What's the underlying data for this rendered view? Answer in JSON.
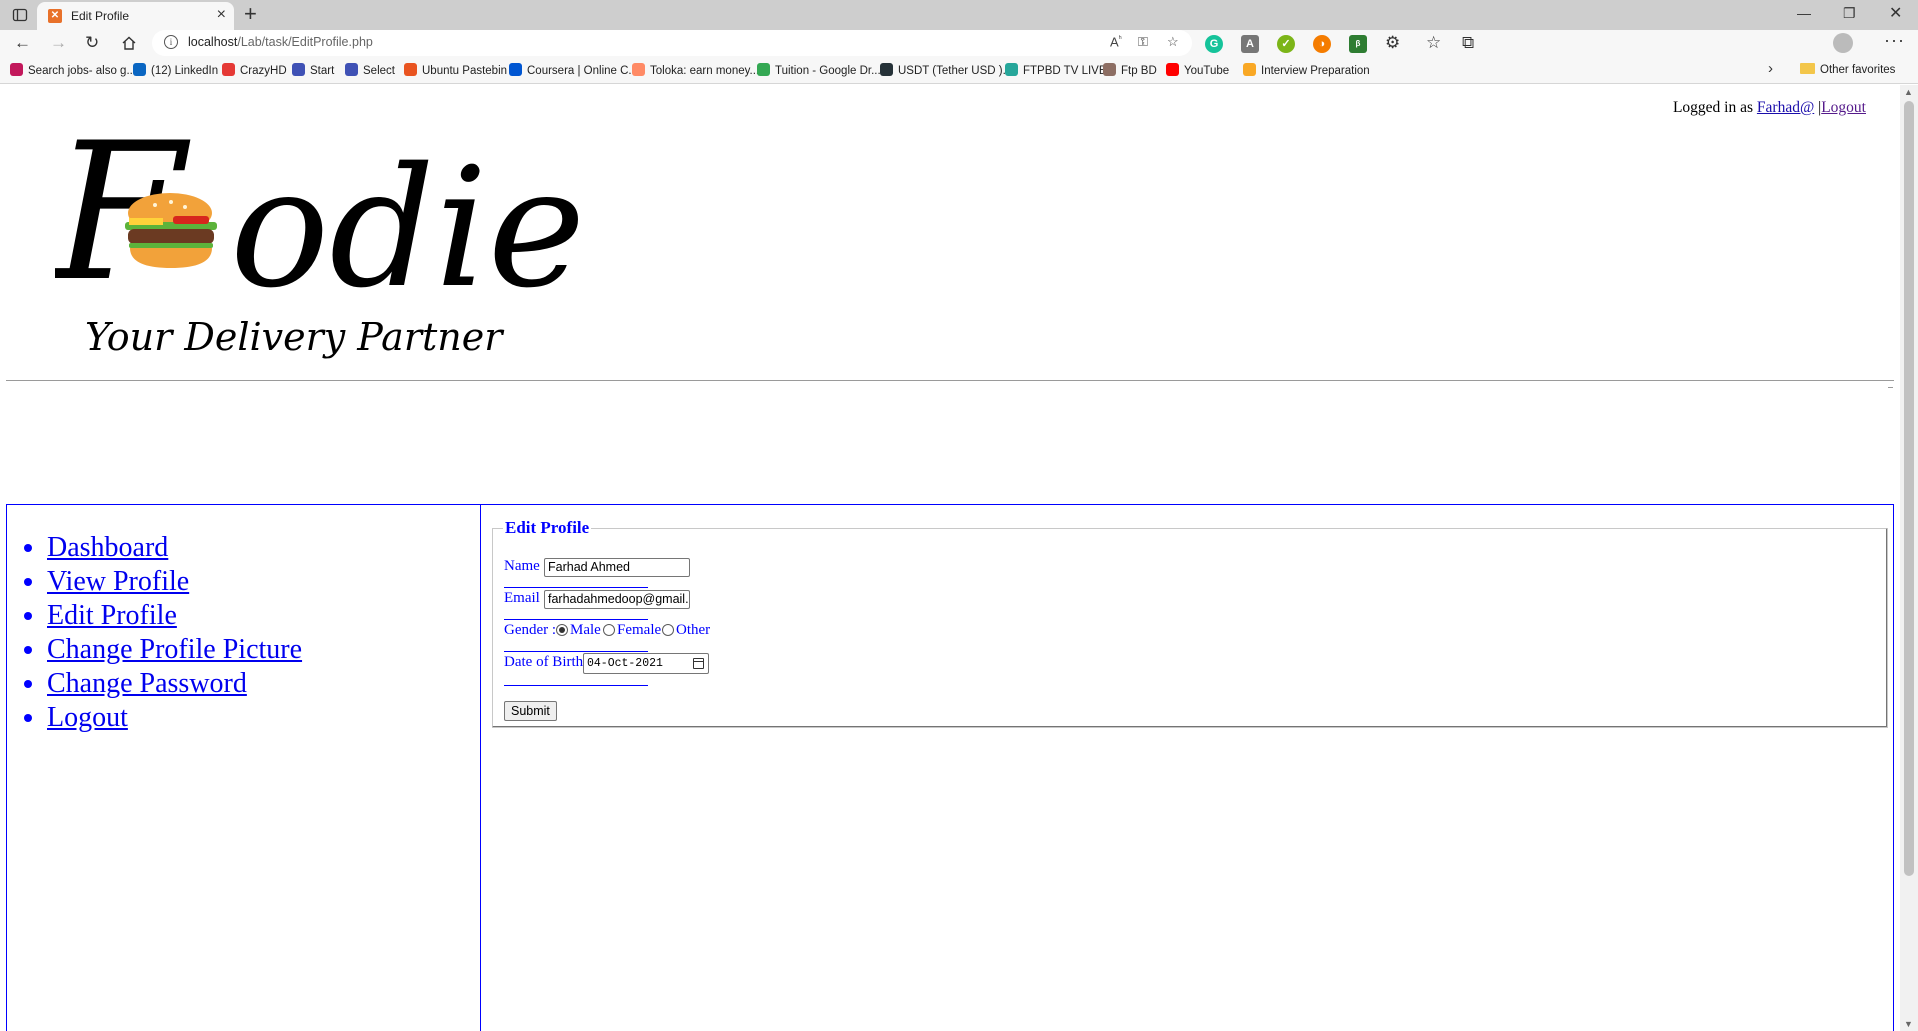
{
  "browser": {
    "tab_title": "Edit Profile",
    "url_host": "localhost",
    "url_path": "/Lab/task/EditProfile.php",
    "bookmarks": [
      {
        "label": "Search jobs- also g...",
        "color": "#c2185b"
      },
      {
        "label": "(12) LinkedIn",
        "color": "#0a66c2"
      },
      {
        "label": "CrazyHD",
        "color": "#e53935"
      },
      {
        "label": "Start",
        "color": "#3f51b5"
      },
      {
        "label": "Select",
        "color": "#3f51b5"
      },
      {
        "label": "Ubuntu Pastebin",
        "color": "#e95420"
      },
      {
        "label": "Coursera | Online C...",
        "color": "#0056d2"
      },
      {
        "label": "Toloka: earn money...",
        "color": "#ff8a65"
      },
      {
        "label": "Tuition - Google Dr...",
        "color": "#34a853"
      },
      {
        "label": "USDT (Tether USD )...",
        "color": "#263238"
      },
      {
        "label": "FTPBD TV LIVE!",
        "color": "#26a69a"
      },
      {
        "label": "Ftp BD",
        "color": "#8d6e63"
      },
      {
        "label": "YouTube",
        "color": "#ff0000"
      },
      {
        "label": "Interview Preparation",
        "color": "#f9a825"
      }
    ],
    "other_favorites": "Other favorites"
  },
  "header": {
    "logged_prefix": "Logged in as ",
    "username": "Farhad@",
    "separator": " |",
    "logout": "Logout"
  },
  "logo": {
    "title_letter_f": "F",
    "title_rest": "odie",
    "tagline": "Your Delivery Partner"
  },
  "sidebar": {
    "items": [
      "Dashboard",
      "View Profile",
      "Edit Profile",
      "Change Profile Picture",
      "Change Password",
      "Logout"
    ]
  },
  "form": {
    "legend": "Edit Profile",
    "name_label": "Name :",
    "name_value": "Farhad Ahmed",
    "email_label": "Email :",
    "email_value": "farhadahmedoop@gmail.com",
    "gender_label": "Gender :",
    "gender_options": [
      "Male",
      "Female",
      "Other"
    ],
    "gender_selected": "Male",
    "dob_label": "Date of Birth :",
    "dob_value": "04-Oct-2021",
    "submit_label": "Submit"
  },
  "colors": {
    "accent_blue": "#0000ff",
    "link": "#1a0dab"
  }
}
